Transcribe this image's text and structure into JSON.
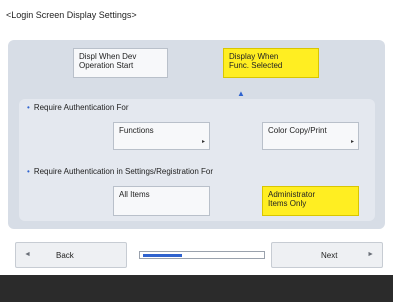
{
  "header": {
    "title": "<Login Screen Display Settings>"
  },
  "display_options": [
    {
      "label": "Displ When Dev\nOperation Start",
      "selected": false
    },
    {
      "label": "Display When\nFunc. Selected",
      "selected": true
    }
  ],
  "sections": {
    "require_auth_for": {
      "heading": "Require Authentication For",
      "buttons": [
        {
          "label": "Functions",
          "selected": false
        },
        {
          "label": "Color Copy/Print",
          "selected": false
        }
      ]
    },
    "require_auth_settings": {
      "heading": "Require Authentication in Settings/Registration For",
      "buttons": [
        {
          "label": "All Items",
          "selected": false
        },
        {
          "label": "Administrator\nItems Only",
          "selected": true
        }
      ]
    }
  },
  "navigation": {
    "back_label": "Back",
    "next_label": "Next",
    "progress": 0.33
  },
  "colors": {
    "selected": "#ffee22",
    "accent": "#2f63cf",
    "panel": "#d7dde6"
  }
}
